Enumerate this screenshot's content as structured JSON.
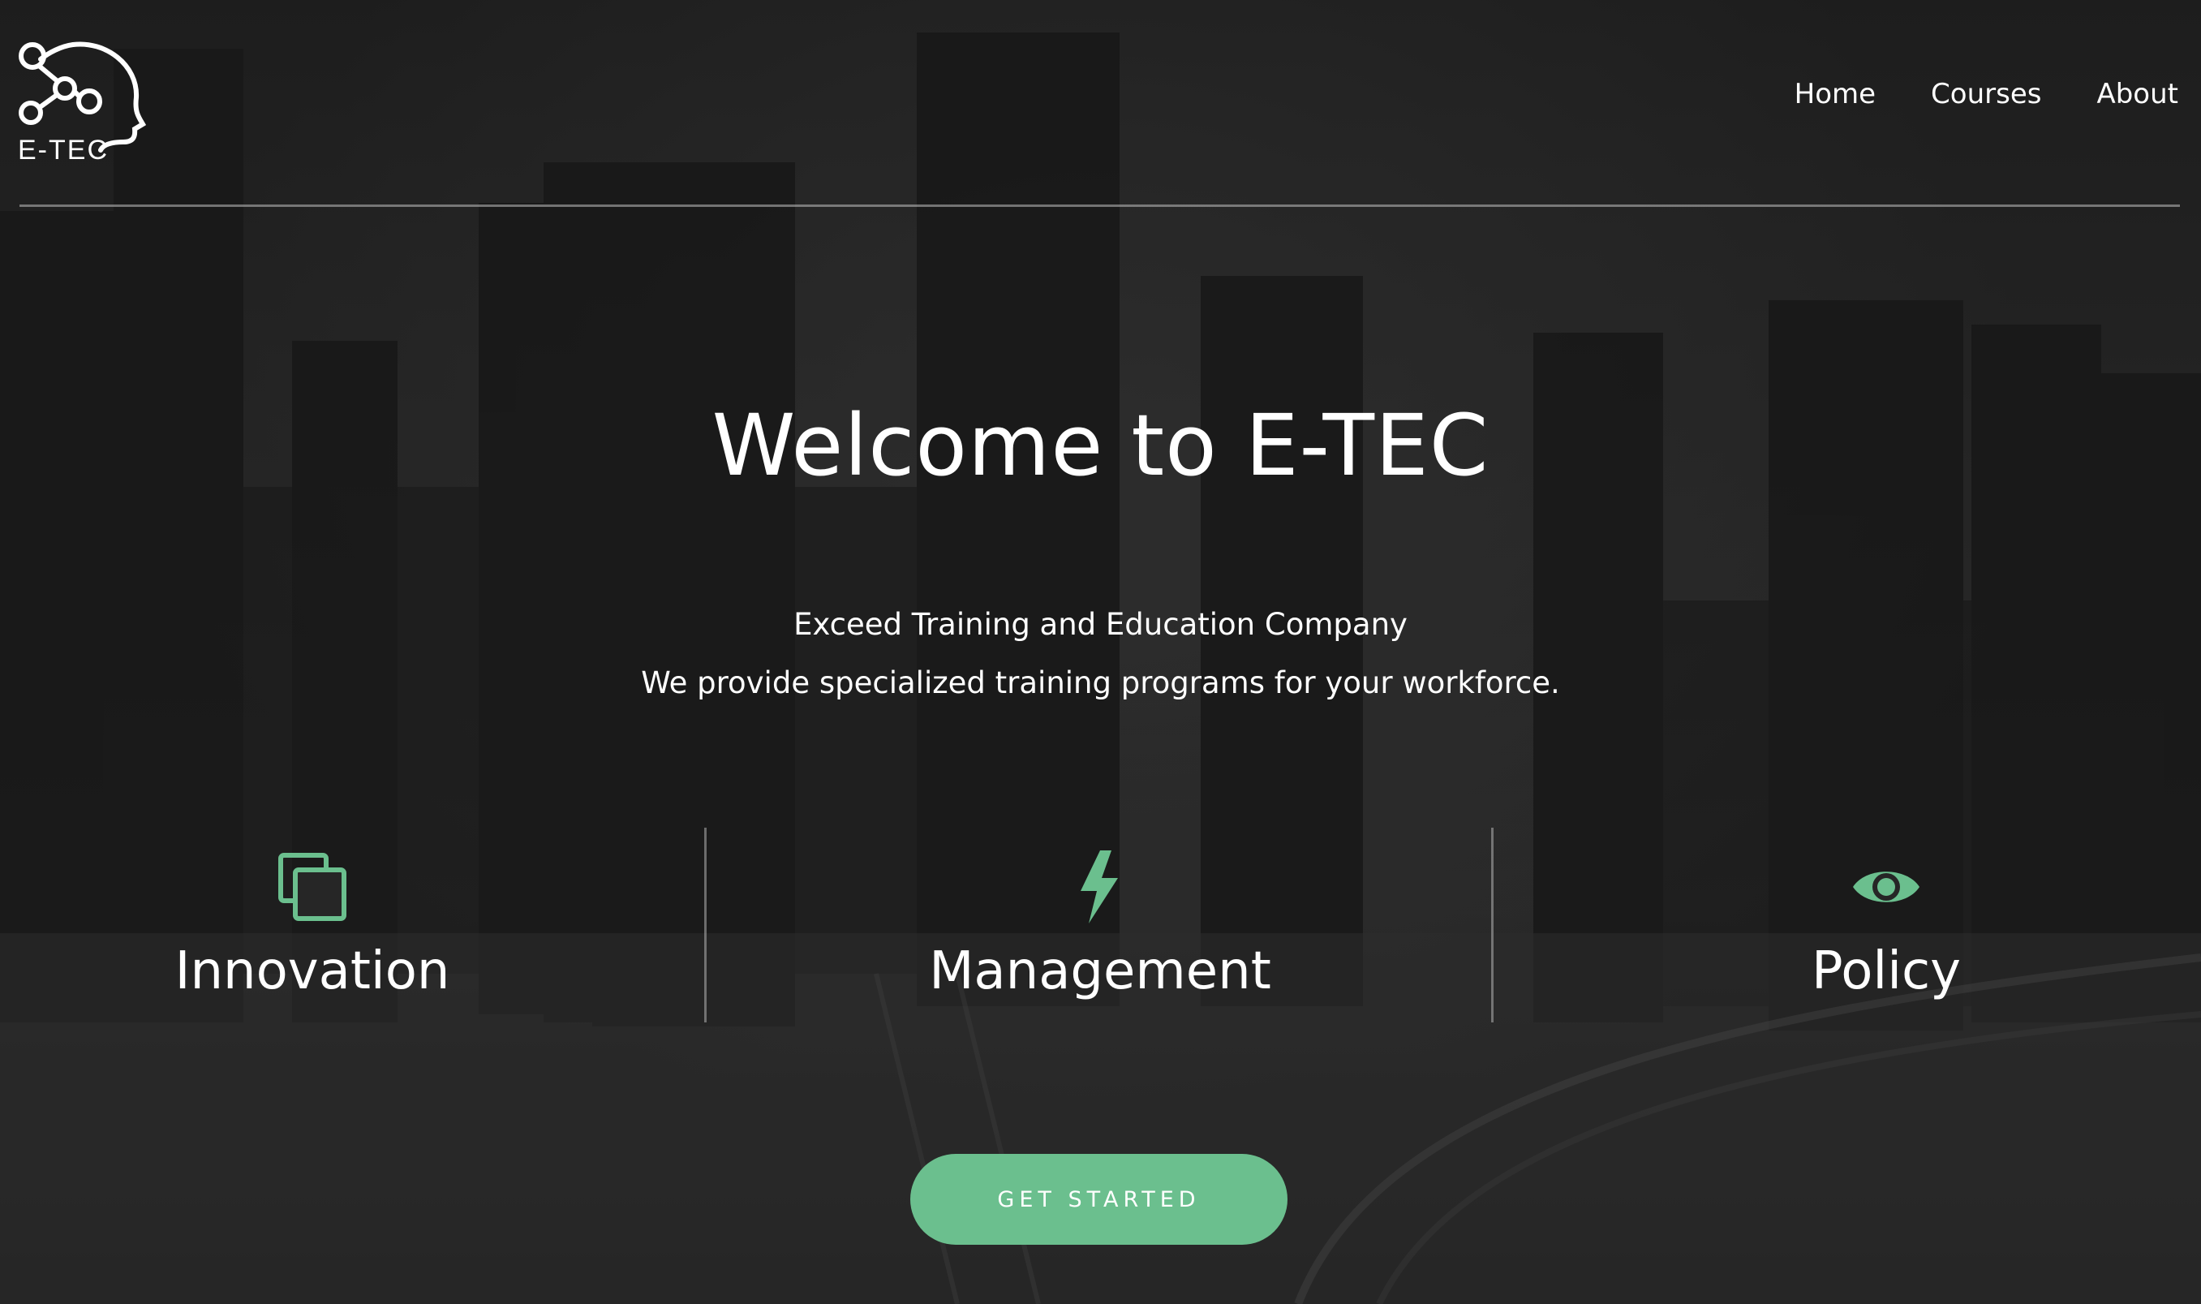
{
  "brand": {
    "name": "E-TEC"
  },
  "nav": {
    "items": [
      "Home",
      "Courses",
      "About"
    ]
  },
  "hero": {
    "title": "Welcome to E-TEC",
    "subtitle_1": "Exceed Training and Education Company",
    "subtitle_2": "We provide specialized training programs for your workforce."
  },
  "features": [
    {
      "label": "Innovation",
      "icon": "copy-squares-icon"
    },
    {
      "label": "Management",
      "icon": "lightning-bolt-icon"
    },
    {
      "label": "Policy",
      "icon": "eye-icon"
    }
  ],
  "cta": {
    "label": "GET STARTED"
  },
  "colors": {
    "accent": "#6bbf8e",
    "text": "#ffffff",
    "background": "#2a2a2a"
  }
}
